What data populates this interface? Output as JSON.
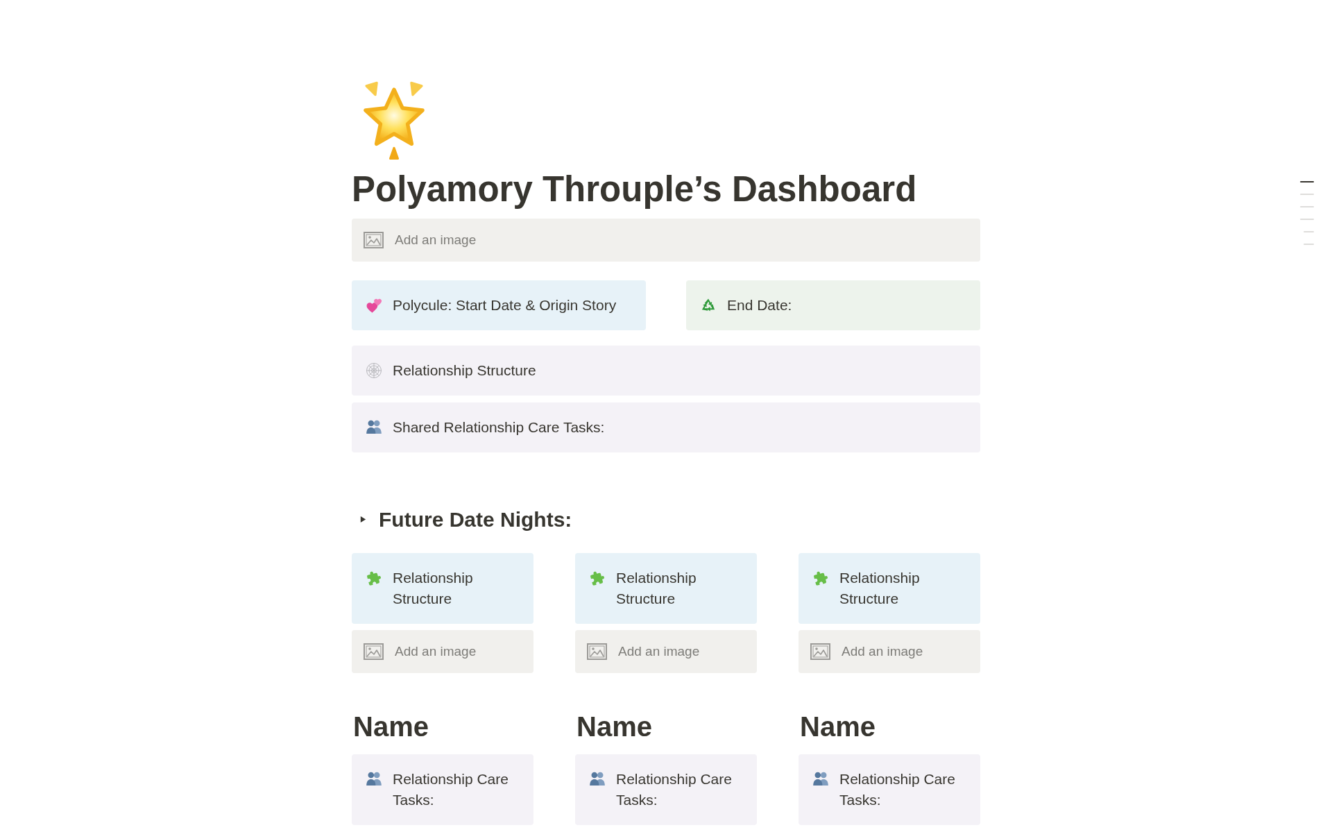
{
  "page": {
    "title": "Polyamory Throuple’s Dashboard"
  },
  "cover": {
    "label": "Add an image"
  },
  "top_callouts": [
    {
      "kind": "hearts",
      "text": "Polycule: Start Date & Origin Story",
      "color": "#e7f2f8"
    },
    {
      "kind": "recycle",
      "text": "End Date:",
      "color": "#edf3ec"
    }
  ],
  "callouts": [
    {
      "kind": "web",
      "text": "Relationship Structure",
      "color": "#f4f2f7"
    },
    {
      "kind": "people",
      "text": "Shared Relationship Care Tasks:",
      "color": "#f4f2f7"
    }
  ],
  "date_nights": {
    "title": "Future Date Nights:",
    "expanded": false,
    "cards": [
      {
        "callout": {
          "kind": "puzzle",
          "text": "Relationship Structure",
          "color": "#e7f2f8"
        },
        "image_label": "Add an image"
      },
      {
        "callout": {
          "kind": "puzzle",
          "text": "Relationship Structure",
          "color": "#e7f2f8"
        },
        "image_label": "Add an image"
      },
      {
        "callout": {
          "kind": "puzzle",
          "text": "Relationship Structure",
          "color": "#e7f2f8"
        },
        "image_label": "Add an image"
      }
    ]
  },
  "partners": [
    {
      "name": "Name",
      "callout": {
        "kind": "people",
        "text": "Relationship Care Tasks:",
        "color": "#f4f2f7"
      }
    },
    {
      "name": "Name",
      "callout": {
        "kind": "people",
        "text": "Relationship Care Tasks:",
        "color": "#f4f2f7"
      }
    },
    {
      "name": "Name",
      "callout": {
        "kind": "people",
        "text": "Relationship Care Tasks:",
        "color": "#f4f2f7"
      }
    }
  ],
  "outline": [
    {
      "selected": true
    },
    {
      "selected": false
    },
    {
      "selected": false
    },
    {
      "selected": false,
      "children": [
        {
          "selected": false
        },
        {
          "selected": false
        }
      ]
    }
  ]
}
